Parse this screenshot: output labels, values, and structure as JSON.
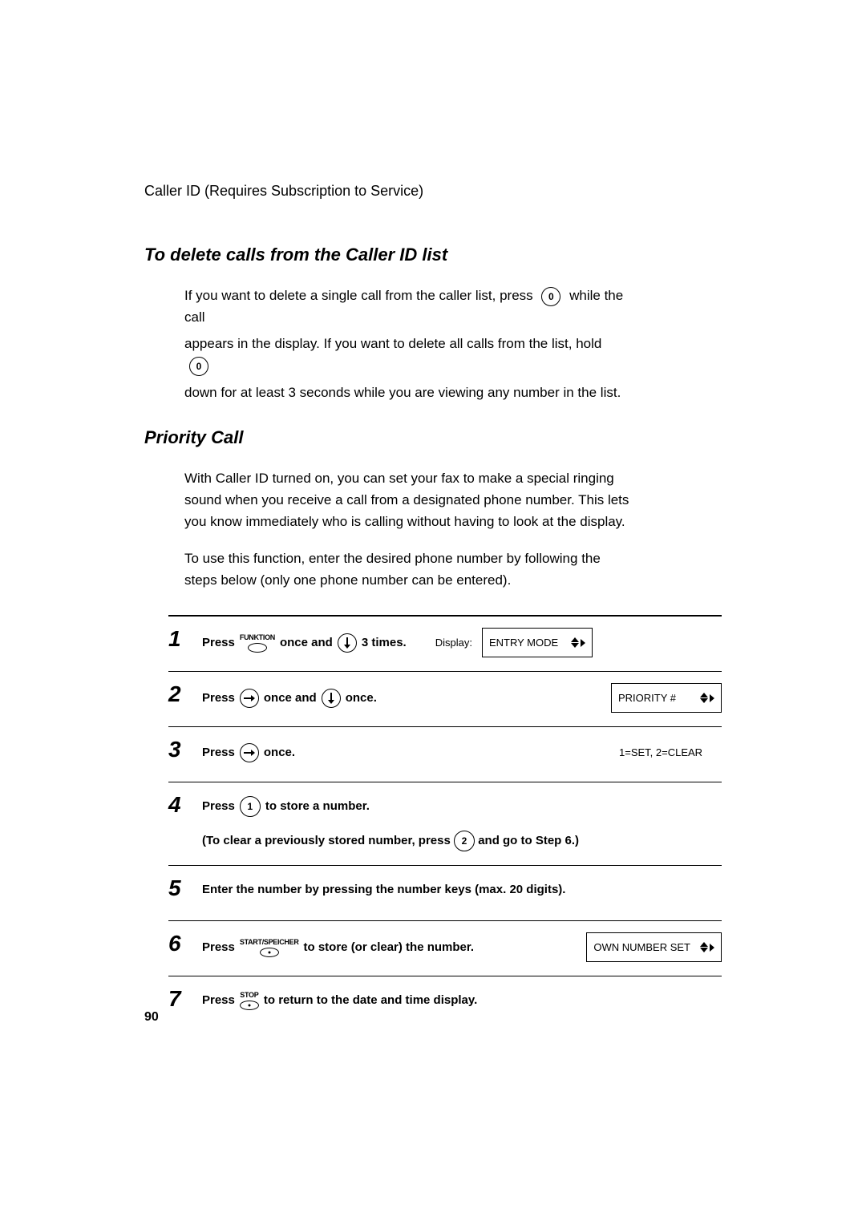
{
  "header": "Caller ID (Requires Subscription to Service)",
  "section1": {
    "title": "To delete calls from the Caller ID list",
    "p1a": "If you want to delete a single call from the caller list, press ",
    "p1b": " while the call",
    "p2a": "appears in the display. If you want to delete all calls from the list, hold ",
    "p3": "down for at least 3 seconds while you are viewing any number in the list.",
    "key": "0"
  },
  "section2": {
    "title": "Priority Call",
    "p1": "With Caller ID turned on, you can set your fax to make a special ringing sound when you receive a call from a designated phone number. This lets you know immediately who is calling without having to look at the display.",
    "p2": "To use this function, enter the desired phone number by following the steps below (only one phone number can be entered)."
  },
  "labels": {
    "press": "Press",
    "once_and": "once and",
    "three_times": "3 times.",
    "once": "once.",
    "display": "Display:",
    "funktion": "FUNKTION",
    "startspeicher": "START/SPEICHER",
    "stop": "STOP"
  },
  "steps": {
    "s1": {
      "num": "1",
      "disp": "ENTRY MODE"
    },
    "s2": {
      "num": "2",
      "disp": "PRIORITY #"
    },
    "s3": {
      "num": "3",
      "disp": "1=SET, 2=CLEAR"
    },
    "s4": {
      "num": "4",
      "a": "to store a number.",
      "b": "(To clear a previously stored number, press",
      "c": "and go to Step 6.)",
      "key1": "1",
      "key2": "2"
    },
    "s5": {
      "num": "5",
      "text": "Enter the number by pressing the number keys (max. 20 digits)."
    },
    "s6": {
      "num": "6",
      "text": "to store (or clear) the number.",
      "disp": "OWN NUMBER SET"
    },
    "s7": {
      "num": "7",
      "text": "to return to the date and time display."
    }
  },
  "page_number": "90"
}
